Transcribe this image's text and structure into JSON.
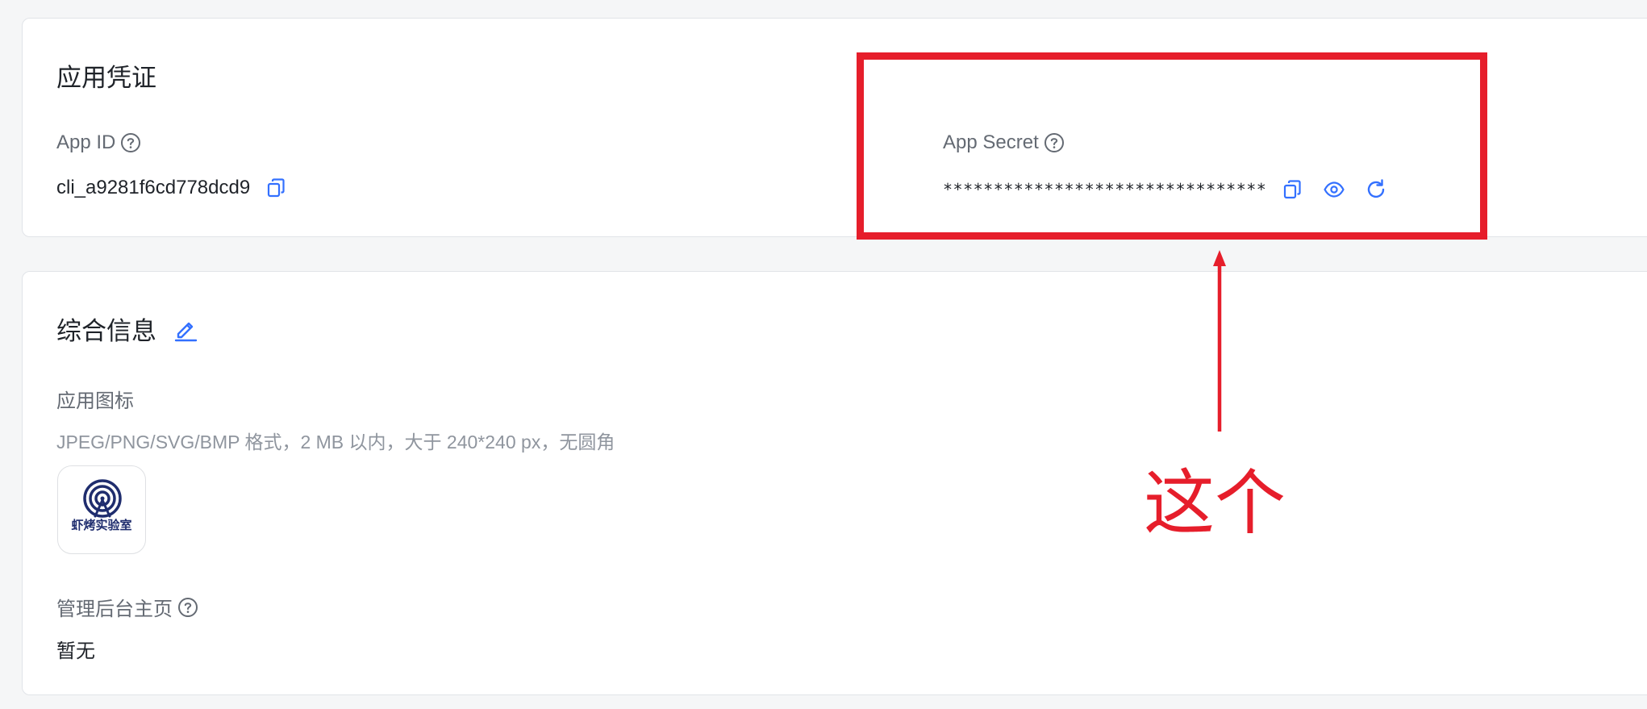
{
  "credentials": {
    "title": "应用凭证",
    "app_id": {
      "label": "App ID",
      "value": "cli_a9281f6cd778dcd9",
      "help_icon": "question-circle-icon",
      "copy_icon": "copy-icon"
    },
    "app_secret": {
      "label": "App Secret",
      "value": "********************************",
      "help_icon": "question-circle-icon",
      "actions": [
        "copy-icon",
        "eye-icon",
        "refresh-icon"
      ]
    }
  },
  "info": {
    "title": "综合信息",
    "edit_icon": "pencil-edit-icon",
    "app_icon": {
      "label": "应用图标",
      "hint": "JPEG/PNG/SVG/BMP 格式，2 MB 以内，大于 240*240 px，无圆角",
      "logo_text": "虾烤实验室"
    },
    "admin_homepage": {
      "label": "管理后台主页",
      "value": "暂无",
      "help_icon": "question-circle-icon"
    }
  },
  "annotation": {
    "text": "这个",
    "color": "#e61e2b"
  },
  "colors": {
    "accent": "#3370ff",
    "logo": "#1f2d6e",
    "annotation": "#e61e2b"
  }
}
